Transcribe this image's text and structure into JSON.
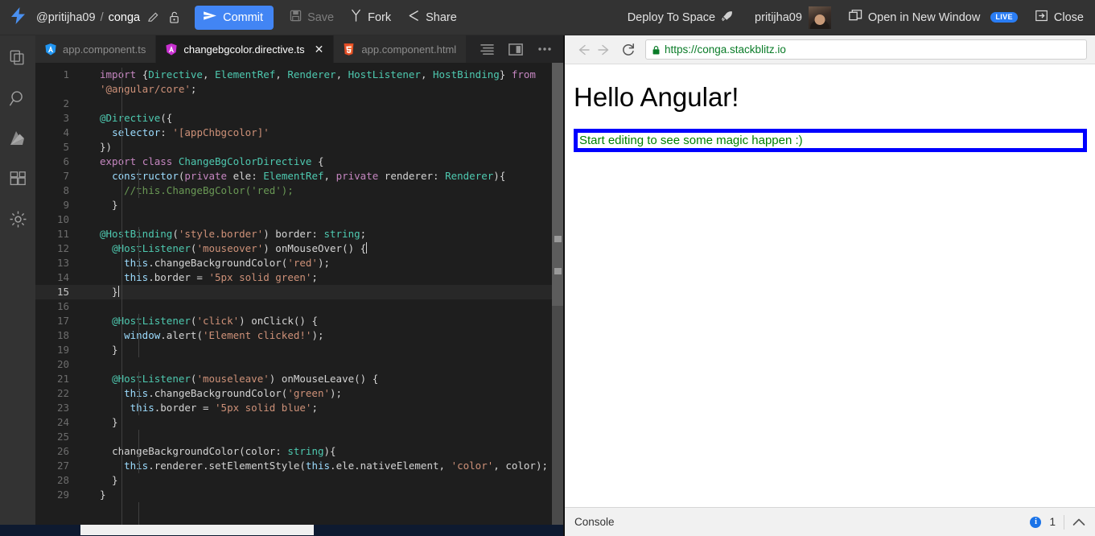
{
  "header": {
    "logo_icon": "bolt-icon",
    "user": "@pritijha09",
    "separator": "/",
    "project": "conga",
    "edit_icon": "pencil-icon",
    "lock_icon": "unlocked-padlock-icon",
    "commit_label": "Commit",
    "commit_icon": "paper-plane-icon",
    "save_label": "Save",
    "save_icon": "floppy-disk-icon",
    "fork_label": "Fork",
    "fork_icon": "fork-icon",
    "share_label": "Share",
    "share_icon": "share-icon",
    "deploy_label": "Deploy To Space",
    "deploy_icon": "rocket-icon",
    "account_name": "pritijha09",
    "avatar_icon": "avatar",
    "open_window_label": "Open in New Window",
    "open_window_icon": "new-window-icon",
    "live_badge": "LIVE",
    "close_label": "Close",
    "close_icon": "exit-arrow-icon",
    "commit_color": "#4285f4",
    "bar_color": "#333333"
  },
  "activity_bar": {
    "items": [
      {
        "icon": "files-icon",
        "name": "files"
      },
      {
        "icon": "search-icon",
        "name": "search"
      },
      {
        "icon": "firebase-icon",
        "name": "firebase"
      },
      {
        "icon": "extensions-icon",
        "name": "dependencies"
      },
      {
        "icon": "gear-icon",
        "name": "settings"
      }
    ]
  },
  "tabs": {
    "items": [
      {
        "label": "app.component.ts",
        "icon": "angular-shield-icon",
        "icon_color": "#2196f3",
        "active": false,
        "closable": false
      },
      {
        "label": "changebgcolor.directive.ts",
        "icon": "angular-shield-icon",
        "icon_color": "#c830d0",
        "active": true,
        "closable": true
      },
      {
        "label": "app.component.html",
        "icon": "html5-icon",
        "icon_color": "#e44d26",
        "active": false,
        "closable": false
      }
    ],
    "close_glyph": "✕",
    "actions": [
      {
        "icon": "format-lines-icon",
        "name": "format-code"
      },
      {
        "icon": "split-editor-icon",
        "name": "split-editor"
      },
      {
        "icon": "more-options-icon",
        "name": "more-options"
      }
    ]
  },
  "editor": {
    "filename": "changebgcolor.directive.ts",
    "cursor_line": 15,
    "total_lines": 29,
    "lines": [
      {
        "n": 1,
        "tokens": [
          [
            "t-key",
            "import "
          ],
          [
            "t-punc",
            "{"
          ],
          [
            "t-type",
            "Directive"
          ],
          [
            "t-punc",
            ", "
          ],
          [
            "t-type",
            "ElementRef"
          ],
          [
            "t-punc",
            ", "
          ],
          [
            "t-type",
            "Renderer"
          ],
          [
            "t-punc",
            ", "
          ],
          [
            "t-type",
            "HostListener"
          ],
          [
            "t-punc",
            ", "
          ],
          [
            "t-type",
            "HostBinding"
          ],
          [
            "t-punc",
            "} "
          ],
          [
            "t-key",
            "from"
          ]
        ]
      },
      {
        "n": "",
        "tokens": [
          [
            "t-str",
            "'@angular/core'"
          ],
          [
            "t-punc",
            ";"
          ]
        ]
      },
      {
        "n": 2,
        "tokens": []
      },
      {
        "n": 3,
        "tokens": [
          [
            "t-deco",
            "@Directive"
          ],
          [
            "t-punc",
            "({"
          ]
        ]
      },
      {
        "n": 4,
        "tokens": [
          [
            "t-punc",
            "  "
          ],
          [
            "t-ident",
            "selector"
          ],
          [
            "t-punc",
            ": "
          ],
          [
            "t-str",
            "'[appChbgcolor]'"
          ]
        ]
      },
      {
        "n": 5,
        "tokens": [
          [
            "t-punc",
            "})"
          ]
        ]
      },
      {
        "n": 6,
        "tokens": [
          [
            "t-key",
            "export "
          ],
          [
            "t-key",
            "class "
          ],
          [
            "t-type",
            "ChangeBgColorDirective"
          ],
          [
            "t-punc",
            " {"
          ]
        ]
      },
      {
        "n": 7,
        "tokens": [
          [
            "t-punc",
            "  "
          ],
          [
            "t-ident",
            "constructor"
          ],
          [
            "t-punc",
            "("
          ],
          [
            "t-key",
            "private "
          ],
          [
            "t-plain",
            "ele"
          ],
          [
            "t-punc",
            ": "
          ],
          [
            "t-type",
            "ElementRef"
          ],
          [
            "t-punc",
            ", "
          ],
          [
            "t-key",
            "private "
          ],
          [
            "t-plain",
            "renderer"
          ],
          [
            "t-punc",
            ": "
          ],
          [
            "t-type",
            "Renderer"
          ],
          [
            "t-punc",
            "){"
          ]
        ]
      },
      {
        "n": 8,
        "tokens": [
          [
            "t-punc",
            "    "
          ],
          [
            "t-cmt",
            "//this.ChangeBgColor('red');"
          ]
        ]
      },
      {
        "n": 9,
        "tokens": [
          [
            "t-punc",
            "  }"
          ]
        ]
      },
      {
        "n": 10,
        "tokens": []
      },
      {
        "n": 11,
        "tokens": [
          [
            "t-deco",
            "@HostBinding"
          ],
          [
            "t-punc",
            "("
          ],
          [
            "t-str",
            "'style.border'"
          ],
          [
            "t-punc",
            ") "
          ],
          [
            "t-plain",
            "border"
          ],
          [
            "t-punc",
            ": "
          ],
          [
            "t-type",
            "string"
          ],
          [
            "t-punc",
            ";"
          ]
        ]
      },
      {
        "n": 12,
        "tokens": [
          [
            "t-punc",
            "  "
          ],
          [
            "t-deco",
            "@HostListener"
          ],
          [
            "t-punc",
            "("
          ],
          [
            "t-str",
            "'mouseover'"
          ],
          [
            "t-punc",
            ") "
          ],
          [
            "t-plain",
            "onMouseOver"
          ],
          [
            "t-punc",
            "() {"
          ]
        ]
      },
      {
        "n": 13,
        "tokens": [
          [
            "t-punc",
            "    "
          ],
          [
            "t-ident",
            "this"
          ],
          [
            "t-punc",
            "."
          ],
          [
            "t-plain",
            "changeBackgroundColor"
          ],
          [
            "t-punc",
            "("
          ],
          [
            "t-str",
            "'red'"
          ],
          [
            "t-punc",
            ");"
          ]
        ]
      },
      {
        "n": 14,
        "tokens": [
          [
            "t-punc",
            "    "
          ],
          [
            "t-ident",
            "this"
          ],
          [
            "t-punc",
            "."
          ],
          [
            "t-plain",
            "border"
          ],
          [
            "t-punc",
            " = "
          ],
          [
            "t-str",
            "'5px solid green'"
          ],
          [
            "t-punc",
            ";"
          ]
        ]
      },
      {
        "n": 15,
        "tokens": [
          [
            "t-punc",
            "  }"
          ]
        ]
      },
      {
        "n": 16,
        "tokens": []
      },
      {
        "n": 17,
        "tokens": [
          [
            "t-punc",
            "  "
          ],
          [
            "t-deco",
            "@HostListener"
          ],
          [
            "t-punc",
            "("
          ],
          [
            "t-str",
            "'click'"
          ],
          [
            "t-punc",
            ") "
          ],
          [
            "t-plain",
            "onClick"
          ],
          [
            "t-punc",
            "() {"
          ]
        ]
      },
      {
        "n": 18,
        "tokens": [
          [
            "t-punc",
            "    "
          ],
          [
            "t-ident",
            "window"
          ],
          [
            "t-punc",
            "."
          ],
          [
            "t-plain",
            "alert"
          ],
          [
            "t-punc",
            "("
          ],
          [
            "t-str",
            "'Element clicked!'"
          ],
          [
            "t-punc",
            ");"
          ]
        ]
      },
      {
        "n": 19,
        "tokens": [
          [
            "t-punc",
            "  }"
          ]
        ]
      },
      {
        "n": 20,
        "tokens": []
      },
      {
        "n": 21,
        "tokens": [
          [
            "t-punc",
            "  "
          ],
          [
            "t-deco",
            "@HostListener"
          ],
          [
            "t-punc",
            "("
          ],
          [
            "t-str",
            "'mouseleave'"
          ],
          [
            "t-punc",
            ") "
          ],
          [
            "t-plain",
            "onMouseLeave"
          ],
          [
            "t-punc",
            "() {"
          ]
        ]
      },
      {
        "n": 22,
        "tokens": [
          [
            "t-punc",
            "    "
          ],
          [
            "t-ident",
            "this"
          ],
          [
            "t-punc",
            "."
          ],
          [
            "t-plain",
            "changeBackgroundColor"
          ],
          [
            "t-punc",
            "("
          ],
          [
            "t-str",
            "'green'"
          ],
          [
            "t-punc",
            ");"
          ]
        ]
      },
      {
        "n": 23,
        "tokens": [
          [
            "t-punc",
            "     "
          ],
          [
            "t-ident",
            "this"
          ],
          [
            "t-punc",
            "."
          ],
          [
            "t-plain",
            "border"
          ],
          [
            "t-punc",
            " = "
          ],
          [
            "t-str",
            "'5px solid blue'"
          ],
          [
            "t-punc",
            ";"
          ]
        ]
      },
      {
        "n": 24,
        "tokens": [
          [
            "t-punc",
            "  }"
          ]
        ]
      },
      {
        "n": 25,
        "tokens": []
      },
      {
        "n": 26,
        "tokens": [
          [
            "t-punc",
            "  "
          ],
          [
            "t-plain",
            "changeBackgroundColor"
          ],
          [
            "t-punc",
            "("
          ],
          [
            "t-plain",
            "color"
          ],
          [
            "t-punc",
            ": "
          ],
          [
            "t-type",
            "string"
          ],
          [
            "t-punc",
            "){"
          ]
        ]
      },
      {
        "n": 27,
        "tokens": [
          [
            "t-punc",
            "    "
          ],
          [
            "t-ident",
            "this"
          ],
          [
            "t-punc",
            "."
          ],
          [
            "t-plain",
            "renderer"
          ],
          [
            "t-punc",
            "."
          ],
          [
            "t-plain",
            "setElementStyle"
          ],
          [
            "t-punc",
            "("
          ],
          [
            "t-ident",
            "this"
          ],
          [
            "t-punc",
            "."
          ],
          [
            "t-plain",
            "ele"
          ],
          [
            "t-punc",
            "."
          ],
          [
            "t-plain",
            "nativeElement"
          ],
          [
            "t-punc",
            ", "
          ],
          [
            "t-str",
            "'color'"
          ],
          [
            "t-punc",
            ", "
          ],
          [
            "t-plain",
            "color"
          ],
          [
            "t-punc",
            ");"
          ]
        ]
      },
      {
        "n": 28,
        "tokens": [
          [
            "t-punc",
            "  }"
          ]
        ]
      },
      {
        "n": 29,
        "tokens": [
          [
            "t-punc",
            "}"
          ]
        ]
      }
    ]
  },
  "preview": {
    "back_icon": "arrow-left-icon",
    "forward_icon": "arrow-right-icon",
    "reload_icon": "reload-icon",
    "lock_icon": "padlock-secure-icon",
    "url": "https://conga.stackblitz.io",
    "heading": "Hello Angular!",
    "paragraph": "Start editing to see some magic happen :)",
    "paragraph_text_color": "#008000",
    "paragraph_border_color": "#0000ff"
  },
  "console": {
    "label": "Console",
    "info_icon": "info-icon",
    "count": "1",
    "expand_icon": "chevron-up-icon"
  }
}
